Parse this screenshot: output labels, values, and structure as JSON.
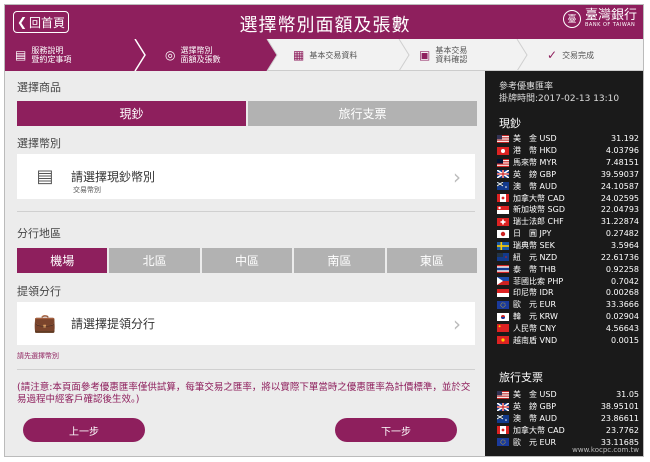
{
  "topbar": {
    "back_label": "回首頁",
    "title": "選擇幣別面額及張數",
    "bank_name": "臺灣銀行",
    "bank_name_en": "BANK OF TAIWAN",
    "seal_char": "臺"
  },
  "steps": [
    {
      "label1": "服務說明",
      "label2": "暨約定事項",
      "icon": "document-icon"
    },
    {
      "label1": "選擇幣別",
      "label2": "面額及張數",
      "icon": "coins-icon"
    },
    {
      "label1": "基本交易資料",
      "label2": "",
      "icon": "form-icon"
    },
    {
      "label1": "基本交易",
      "label2": "資料確認",
      "icon": "confirm-doc-icon"
    },
    {
      "label1": "交易完成",
      "label2": "",
      "icon": "check-circle-icon"
    }
  ],
  "product": {
    "section_label": "選擇商品",
    "options": [
      "現鈔",
      "旅行支票"
    ],
    "selected": "現鈔"
  },
  "currency": {
    "section_label": "選擇幣別",
    "placeholder": "請選擇現鈔幣別",
    "sub_label": "交易幣別"
  },
  "region": {
    "section_label": "分行地區",
    "options": [
      "機場",
      "北區",
      "中區",
      "南區",
      "東區"
    ],
    "selected": "機場"
  },
  "branch": {
    "section_label": "提領分行",
    "placeholder": "請選擇提領分行",
    "hint": "請先選擇幣別"
  },
  "note": "(請注意:本頁面參考優惠匯率僅供試算，每筆交易之匯率，將以實際下單當時之優惠匯率為計價標準，並於交易過程中經客戶確認後生效。)",
  "buttons": {
    "prev": "上一步",
    "next": "下一步"
  },
  "rates": {
    "title": "參考優惠匯率",
    "timestamp": "掛牌時間:2017-02-13 13:10",
    "cash_header": "現鈔",
    "cash": [
      {
        "name": "美　金 USD",
        "value": "31.192",
        "flag": "us"
      },
      {
        "name": "港　幣 HKD",
        "value": "4.03796",
        "flag": "hk"
      },
      {
        "name": "馬來幣 MYR",
        "value": "7.48151",
        "flag": "my"
      },
      {
        "name": "英　鎊 GBP",
        "value": "39.59037",
        "flag": "gb"
      },
      {
        "name": "澳　幣 AUD",
        "value": "24.10587",
        "flag": "au"
      },
      {
        "name": "加拿大幣 CAD",
        "value": "24.02595",
        "flag": "ca"
      },
      {
        "name": "新加坡幣 SGD",
        "value": "22.04793",
        "flag": "sg"
      },
      {
        "name": "瑞士法郎 CHF",
        "value": "31.22874",
        "flag": "ch"
      },
      {
        "name": "日　圓 JPY",
        "value": "0.27482",
        "flag": "jp"
      },
      {
        "name": "瑞典幣 SEK",
        "value": "3.5964",
        "flag": "se"
      },
      {
        "name": "紐　元 NZD",
        "value": "22.61736",
        "flag": "nz"
      },
      {
        "name": "泰　幣 THB",
        "value": "0.92258",
        "flag": "th"
      },
      {
        "name": "菲國比索 PHP",
        "value": "0.7042",
        "flag": "ph"
      },
      {
        "name": "印尼幣 IDR",
        "value": "0.00268",
        "flag": "id"
      },
      {
        "name": "歐　元 EUR",
        "value": "33.3666",
        "flag": "eu"
      },
      {
        "name": "韓　元 KRW",
        "value": "0.02904",
        "flag": "kr"
      },
      {
        "name": "人民幣 CNY",
        "value": "4.56643",
        "flag": "cn"
      },
      {
        "name": "越南盾 VND",
        "value": "0.0015",
        "flag": "vn"
      }
    ],
    "tc_header": "旅行支票",
    "tc": [
      {
        "name": "美　金 USD",
        "value": "31.05",
        "flag": "us"
      },
      {
        "name": "英　鎊 GBP",
        "value": "38.95101",
        "flag": "gb"
      },
      {
        "name": "澳　幣 AUD",
        "value": "23.86611",
        "flag": "au"
      },
      {
        "name": "加拿大幣 CAD",
        "value": "23.7762",
        "flag": "ca"
      },
      {
        "name": "歐　元 EUR",
        "value": "33.11685",
        "flag": "eu"
      }
    ]
  },
  "watermark": "www.kocpc.com.tw",
  "colors": {
    "accent": "#8e1f5d",
    "inactive": "#b2b2b2",
    "panel": "#1a1a1a"
  }
}
